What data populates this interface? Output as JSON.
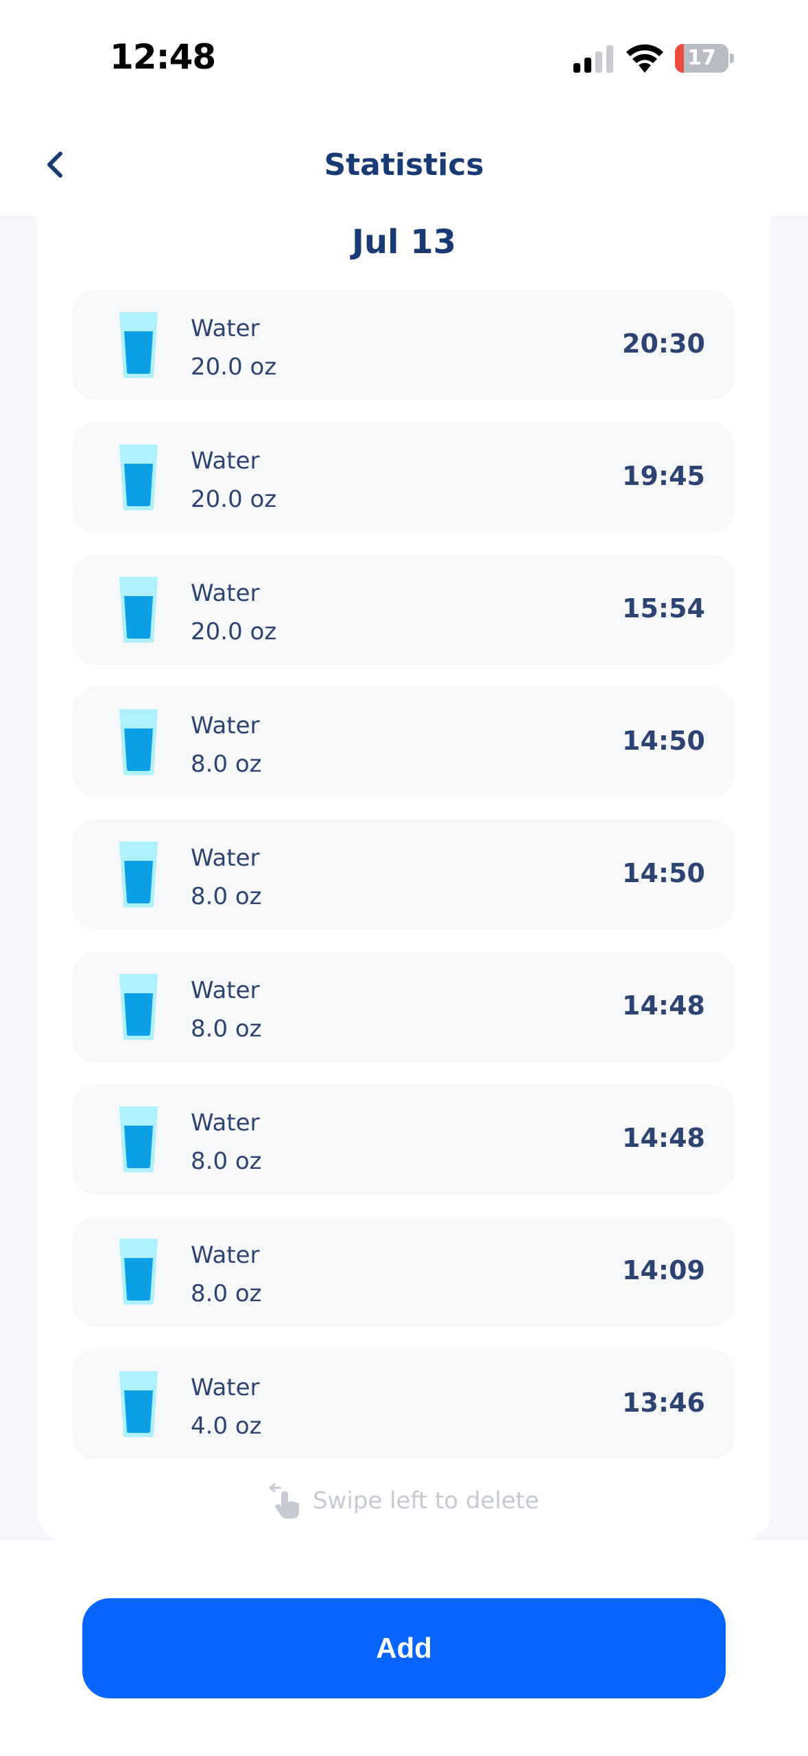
{
  "status_bar": {
    "time": "12:48",
    "battery_percent": "17",
    "battery_level": 0.17,
    "icons": [
      "cellular-signal-icon",
      "wifi-icon",
      "battery-icon"
    ]
  },
  "nav": {
    "title": "Statistics",
    "back_icon": "chevron-left-icon"
  },
  "date": "Jul 13",
  "entries": [
    {
      "name": "Water",
      "amount": "20.0 oz",
      "time": "20:30",
      "icon": "water-glass-icon"
    },
    {
      "name": "Water",
      "amount": "20.0 oz",
      "time": "19:45",
      "icon": "water-glass-icon"
    },
    {
      "name": "Water",
      "amount": "20.0 oz",
      "time": "15:54",
      "icon": "water-glass-icon"
    },
    {
      "name": "Water",
      "amount": "8.0 oz",
      "time": "14:50",
      "icon": "water-glass-icon"
    },
    {
      "name": "Water",
      "amount": "8.0 oz",
      "time": "14:50",
      "icon": "water-glass-icon"
    },
    {
      "name": "Water",
      "amount": "8.0 oz",
      "time": "14:48",
      "icon": "water-glass-icon"
    },
    {
      "name": "Water",
      "amount": "8.0 oz",
      "time": "14:48",
      "icon": "water-glass-icon"
    },
    {
      "name": "Water",
      "amount": "8.0 oz",
      "time": "14:09",
      "icon": "water-glass-icon"
    },
    {
      "name": "Water",
      "amount": "4.0 oz",
      "time": "13:46",
      "icon": "water-glass-icon"
    }
  ],
  "hint": {
    "text": "Swipe left to delete",
    "icon": "swipe-hand-icon"
  },
  "add_button": {
    "label": "Add"
  },
  "colors": {
    "accent": "#0866ff",
    "title_text": "#1a3a73",
    "row_background": "#f6f8fa",
    "glass_light": "#aef0fb",
    "glass_water": "#0ea0e6",
    "battery_low": "#eb4d3d"
  }
}
